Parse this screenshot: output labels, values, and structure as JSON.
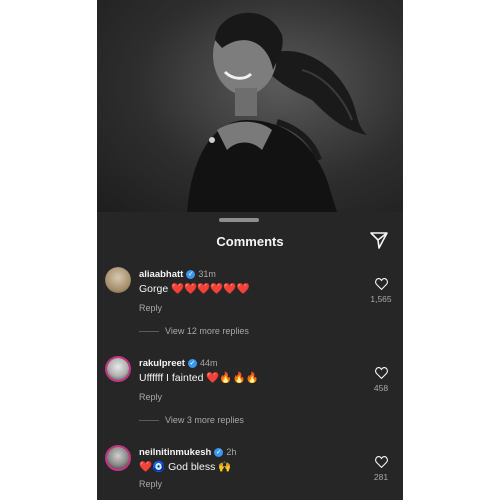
{
  "sheet": {
    "title": "Comments"
  },
  "comments": [
    {
      "username": "aliaabhatt",
      "time": "31m",
      "text": "Gorge ❤️❤️❤️❤️❤️❤️",
      "reply_label": "Reply",
      "like_count": "1,565",
      "more_replies": "View 12 more replies"
    },
    {
      "username": "rakulpreet",
      "time": "44m",
      "text": "Uffffff I fainted ❤️🔥🔥🔥",
      "reply_label": "Reply",
      "like_count": "458",
      "more_replies": "View 3 more replies"
    },
    {
      "username": "neilnitinmukesh",
      "time": "2h",
      "text": "❤️🧿 God bless 🙌",
      "reply_label": "Reply",
      "like_count": "281"
    }
  ],
  "colors": {
    "background": "#262626",
    "text": "#f5f5f5",
    "secondary_text": "#a8a8a8",
    "verified": "#3897f0",
    "story_ring": "#c13584"
  },
  "icons": {
    "share": "paper-plane-icon",
    "like": "heart-outline-icon",
    "verified": "verified-badge-icon"
  }
}
